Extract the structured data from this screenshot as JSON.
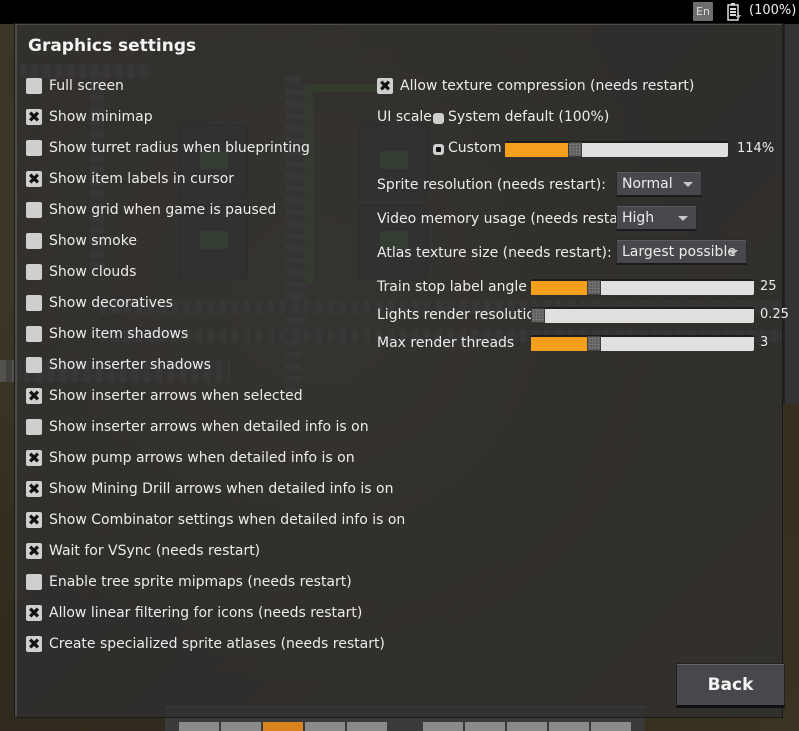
{
  "system_bar": {
    "language": "En",
    "battery_icon": "battery-charging-icon",
    "battery_text": "(100%)"
  },
  "dialog": {
    "title": "Graphics settings",
    "left_options": [
      {
        "label": "Full screen",
        "checked": false
      },
      {
        "label": "Show minimap",
        "checked": true
      },
      {
        "label": "Show turret radius when blueprinting",
        "checked": false
      },
      {
        "label": "Show item labels in cursor",
        "checked": true
      },
      {
        "label": "Show grid when game is paused",
        "checked": false
      },
      {
        "label": "Show smoke",
        "checked": false
      },
      {
        "label": "Show clouds",
        "checked": false
      },
      {
        "label": "Show decoratives",
        "checked": false
      },
      {
        "label": "Show item shadows",
        "checked": false
      },
      {
        "label": "Show inserter shadows",
        "checked": false
      },
      {
        "label": "Show inserter arrows when selected",
        "checked": true
      },
      {
        "label": "Show inserter arrows when detailed info is on",
        "checked": false
      },
      {
        "label": "Show pump arrows when detailed info is on",
        "checked": true
      },
      {
        "label": "Show Mining Drill arrows when detailed info is on",
        "checked": true
      },
      {
        "label": "Show Combinator settings when detailed info is on",
        "checked": true
      },
      {
        "label": "Wait for VSync (needs restart)",
        "checked": true
      },
      {
        "label": "Enable tree sprite mipmaps (needs restart)",
        "checked": false
      },
      {
        "label": "Allow linear filtering for icons (needs restart)",
        "checked": true
      },
      {
        "label": "Create specialized sprite atlases (needs restart)",
        "checked": true
      }
    ],
    "texture_compression": {
      "label": "Allow texture compression (needs restart)",
      "checked": true
    },
    "ui_scale": {
      "label": "UI scale",
      "options": [
        {
          "label": "System default (100%)",
          "selected": false
        },
        {
          "label": "Custom",
          "selected": true
        }
      ],
      "custom_value_text": "114%",
      "custom_fraction": 0.3
    },
    "dropdowns": [
      {
        "label": "Sprite resolution (needs restart):",
        "value": "Normal"
      },
      {
        "label": "Video memory usage (needs restart):",
        "value": "High"
      },
      {
        "label": "Atlas texture size (needs restart):",
        "value": "Largest possible"
      }
    ],
    "sliders": [
      {
        "label": "Train stop label angle",
        "value_text": "25",
        "fraction": 0.27
      },
      {
        "label": "Lights render resolution",
        "value_text": "0.25",
        "fraction": 0.0
      },
      {
        "label": "Max render threads",
        "value_text": "3",
        "fraction": 0.27
      }
    ],
    "back_label": "Back"
  },
  "colors": {
    "accent_orange": "#f49f1e",
    "slider_track": "#e0e0e0",
    "button_bg": "#48474b"
  }
}
